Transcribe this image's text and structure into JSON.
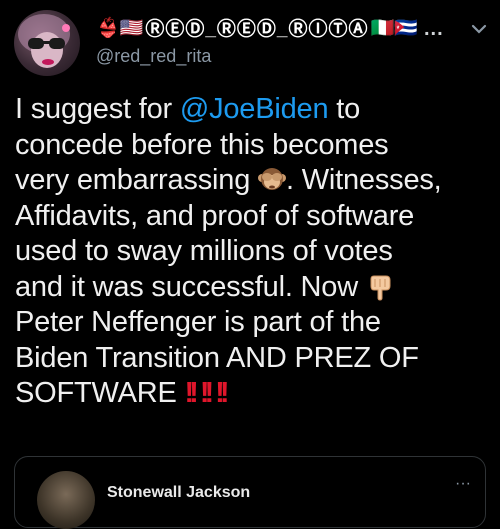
{
  "tweet": {
    "display_name_prefix": "👙🇺🇸",
    "display_name_circled": "ⓇⒺⒹ_ⓇⒺⒹ_ⓇⒾⓉⒶ",
    "display_name_suffix": "🇮🇹🇨🇺",
    "handle": "@red_red_rita",
    "more_label": "...",
    "text": {
      "line1_pre": "I suggest for ",
      "mention": "@JoeBiden",
      "line1_post": " to",
      "line2": "concede before this becomes",
      "line3_pre": "very embarrassing ",
      "line3_post": ". Witnesses,",
      "line4": "Affidavits, and proof of software",
      "line5": "used  to sway millions of votes",
      "line6_pre": "and it was successful. Now ",
      "line7": "Peter Neffenger is part of the",
      "line8": "Biden Transition AND PREZ OF",
      "line9": "SOFTWARE",
      "bangs": "!!"
    }
  },
  "quoted_tweet": {
    "name": "Stonewall Jackson",
    "more_label": "···"
  },
  "colors": {
    "mention": "#1d9bf0",
    "background": "#000000",
    "bangs": "#e0162b"
  },
  "icons": [
    "avatar",
    "see-no-evil-monkey-icon",
    "pointing-down-hand-icon",
    "double-exclamation-icon",
    "more-icon",
    "chevron-down-icon"
  ]
}
